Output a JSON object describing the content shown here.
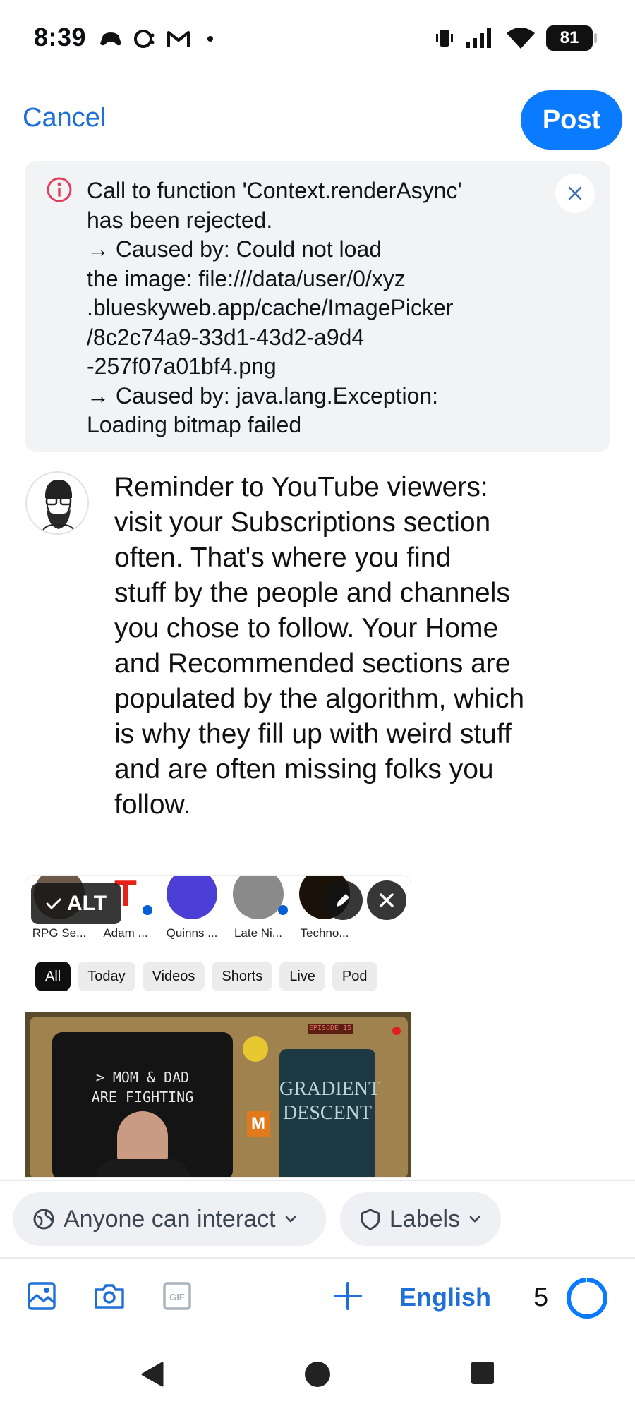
{
  "status_bar": {
    "time": "8:39",
    "battery": "81"
  },
  "header": {
    "cancel_label": "Cancel",
    "post_label": "Post"
  },
  "error": {
    "message": "Call to function 'Context.renderAsync'\nhas been rejected.\n→ Caused by: Could not load\nthe image: file:///data/user/0/xyz\n.blueskyweb.app/cache/ImagePicker\n/8c2c74a9-33d1-43d2-a9d4\n-257f07a01bf4.png\n→ Caused by: java.lang.Exception:\nLoading bitmap failed"
  },
  "composer": {
    "text": "Reminder to YouTube viewers:\nvisit your Subscriptions section\noften. That's where you find\nstuff by the people and channels\nyou chose to follow. Your Home\nand Recommended sections are\npopulated by the algorithm, which\nis why they fill up with weird stuff\nand are often missing folks you\nfollow."
  },
  "attachment": {
    "alt_label": "ALT",
    "channels": [
      "RPG Se...",
      "Adam ...",
      "Quinns ...",
      "Late Ni...",
      "Techno..."
    ],
    "chips": [
      "All",
      "Today",
      "Videos",
      "Shorts",
      "Live",
      "Pod"
    ],
    "thumb_caption": "> MOM & DAD\nARE FIGHTING",
    "thumb_episode": "EPISODE 15",
    "thumb_title": "GRADIENT\nDESCENT"
  },
  "interaction": {
    "anyone_label": "Anyone can interact",
    "labels_label": "Labels"
  },
  "toolbar": {
    "language": "English",
    "char_count": "5"
  },
  "colors": {
    "accent": "#0a7aff",
    "link": "#1e6fd9",
    "error_icon": "#e0405e"
  }
}
